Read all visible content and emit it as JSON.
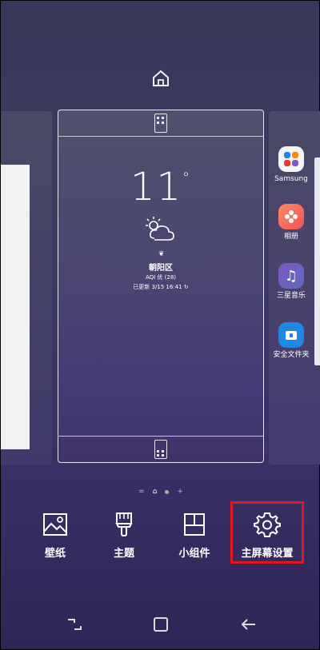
{
  "home_pages": {
    "weather": {
      "temperature": "11",
      "degree": "°",
      "city": "朝阳区",
      "aqi": "AQI 优 (28)",
      "updated": "已更新 3/15 16:41"
    },
    "right_apps": [
      {
        "label": "Samsung",
        "icon": "samsung-folder-icon"
      },
      {
        "label": "相册",
        "icon": "gallery-icon"
      },
      {
        "label": "三星音乐",
        "icon": "music-icon"
      },
      {
        "label": "安全文件夹",
        "icon": "secure-folder-icon"
      }
    ]
  },
  "page_indicator": {
    "left": "=",
    "plus": "+"
  },
  "menu": {
    "wallpaper": "壁纸",
    "theme": "主题",
    "widgets": "小组件",
    "home_settings": "主屏幕设置"
  },
  "colors": {
    "highlight": "#e01a1a",
    "background": "#3b3a60"
  }
}
